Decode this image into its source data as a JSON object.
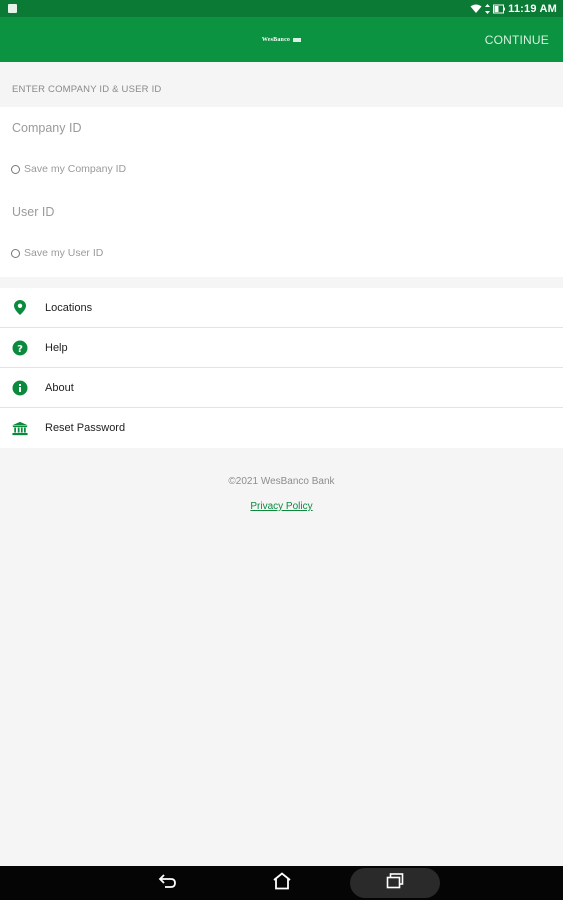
{
  "status_bar": {
    "time": "11:19 AM",
    "icons": [
      "notification-icon",
      "wifi-icon",
      "battery-icon"
    ]
  },
  "app_bar": {
    "logo_text": "WesBanco",
    "continue_label": "CONTINUE",
    "background_color": "#0b9341"
  },
  "form": {
    "section_title": "ENTER COMPANY ID & USER ID",
    "company_id_placeholder": "Company ID",
    "company_id_value": "",
    "save_company_label": "Save my Company ID",
    "user_id_placeholder": "User ID",
    "user_id_value": "",
    "save_user_label": "Save my User ID"
  },
  "menu": {
    "items": [
      {
        "label": "Locations",
        "icon": "location-pin-icon"
      },
      {
        "label": "Help",
        "icon": "help-icon"
      },
      {
        "label": "About",
        "icon": "info-icon"
      },
      {
        "label": "Reset Password",
        "icon": "bank-icon"
      }
    ],
    "icon_color": "#0b8a3e"
  },
  "footer": {
    "copyright": "©2021 WesBanco Bank",
    "privacy_link": "Privacy Policy"
  },
  "nav_bar": {
    "buttons": [
      "back-icon",
      "home-icon",
      "recents-icon"
    ]
  }
}
